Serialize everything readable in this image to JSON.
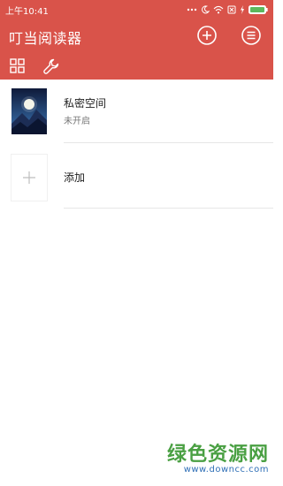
{
  "status_bar": {
    "time": "上午10:41",
    "icons": [
      "dots-icon",
      "moon-icon",
      "wifi-icon",
      "sim-icon",
      "charging-icon",
      "battery-icon"
    ]
  },
  "app": {
    "title": "叮当阅读器",
    "accent_color": "#d9534a"
  },
  "items": [
    {
      "title": "私密空间",
      "subtitle": "未开启"
    },
    {
      "title": "添加"
    }
  ],
  "watermark": {
    "main": "绿色资源网",
    "url": "www.downcc.com"
  }
}
